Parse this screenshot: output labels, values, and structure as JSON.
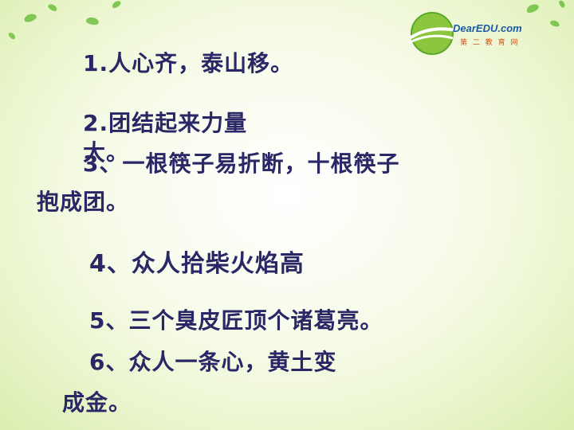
{
  "logo": {
    "brand": "DearEDU.com",
    "subtitle": "第 二 教 育 网"
  },
  "lines": [
    "1.人心齐，泰山移。",
    "2.团结起来力量",
    "大。",
    "3、一根筷子易折断，十根筷子",
    "抱成团。",
    "4、众人拾柴火焰高",
    "5、三个臭皮匠顶个诸葛亮。",
    "6、众人一条心，黄土变",
    "成金。"
  ],
  "colors": {
    "text": "#2a2766",
    "leaf": "#6fbf3f",
    "logo_blue": "#1c5aa6",
    "logo_orange": "#d9541c"
  }
}
